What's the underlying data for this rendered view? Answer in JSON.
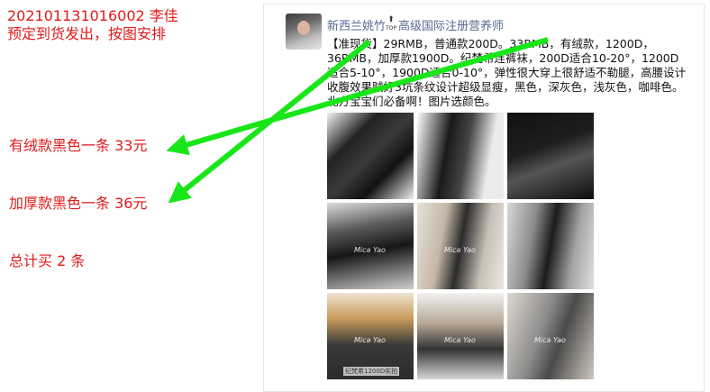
{
  "annotations": {
    "order_id_line": "202101131016002    李佳",
    "instruction_line": "预定到货发出，按图安排",
    "item1": "有绒款黑色一条 33元",
    "item2": "加厚款黑色一条 36元",
    "total": "总计买 2 条"
  },
  "post": {
    "poster_name": "新西兰姚竹",
    "badge_text": "TOP",
    "poster_title": "高级国际注册营养师",
    "body_text": "【准现货】29RMB，普通款200D。33RMB，有绒款，1200D，36RMB，加厚款1900D。纪梵希连裤袜，200D适合10-20°，1200D适合5-10°，1900D适合0-10°，弹性很大穿上很舒适不勒腿，高腰设计收腹效果贼好3坑条纹设计超级显瘦，黑色，深灰色，浅灰色，咖啡色。北方宝宝们必备啊！图片选颜色。",
    "photos": [
      {
        "watermark": "",
        "caption": ""
      },
      {
        "watermark": "",
        "caption": ""
      },
      {
        "watermark": "",
        "caption": ""
      },
      {
        "watermark": "Mica Yao",
        "caption": ""
      },
      {
        "watermark": "Mica Yao",
        "caption": ""
      },
      {
        "watermark": "",
        "caption": ""
      },
      {
        "watermark": "Mica Yao",
        "caption": "纪梵希1200D实拍"
      },
      {
        "watermark": "Mica Yao",
        "caption": ""
      },
      {
        "watermark": "Mica Yao",
        "caption": ""
      }
    ]
  },
  "colors": {
    "annotation_red": "#e01a1a",
    "arrow_green": "#19e619",
    "link_blue": "#576b95"
  }
}
